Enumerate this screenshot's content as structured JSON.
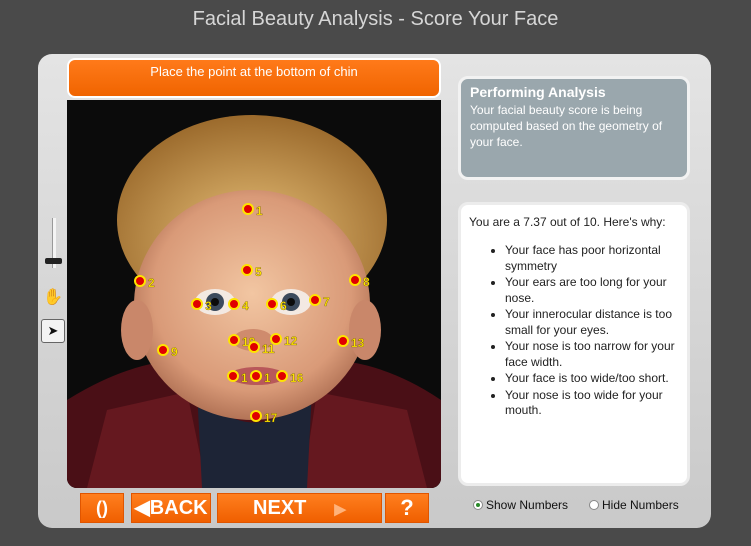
{
  "header": {
    "title": "Facial Beauty Analysis - Score Your Face"
  },
  "instruction": {
    "text": "Place the point at the bottom of chin"
  },
  "landmarks": [
    "1",
    "2",
    "3",
    "4",
    "5",
    "6",
    "7",
    "8",
    "9",
    "10",
    "11",
    "12",
    "13",
    "1",
    "1",
    "16",
    "17"
  ],
  "analysis": {
    "title": "Performing Analysis",
    "body": "Your facial beauty score is being computed based on the geometry of your face."
  },
  "results": {
    "score_text": "You are a 7.37 out of 10.  Here's why:",
    "reasons": [
      "Your face has poor horizontal symmetry",
      "Your ears are too long for your nose.",
      "Your innerocular distance is too small for your eyes.",
      "Your nose is too narrow for your face width.",
      "Your face is too wide/too short.",
      "Your nose is too wide for your mouth."
    ]
  },
  "buttons": {
    "reset": "()",
    "back": "◀BACK",
    "next": "NEXT",
    "next_arrow": "▶",
    "help": "?"
  },
  "display_options": {
    "show_numbers": "Show Numbers",
    "hide_numbers": "Hide Numbers",
    "selected": "Show Numbers"
  },
  "tools": {
    "hand": "hand-tool",
    "arrow": "arrow-tool"
  },
  "colors": {
    "accent": "#f26a00",
    "landmark_fill": "#e00000",
    "landmark_ring": "#ffe400"
  }
}
